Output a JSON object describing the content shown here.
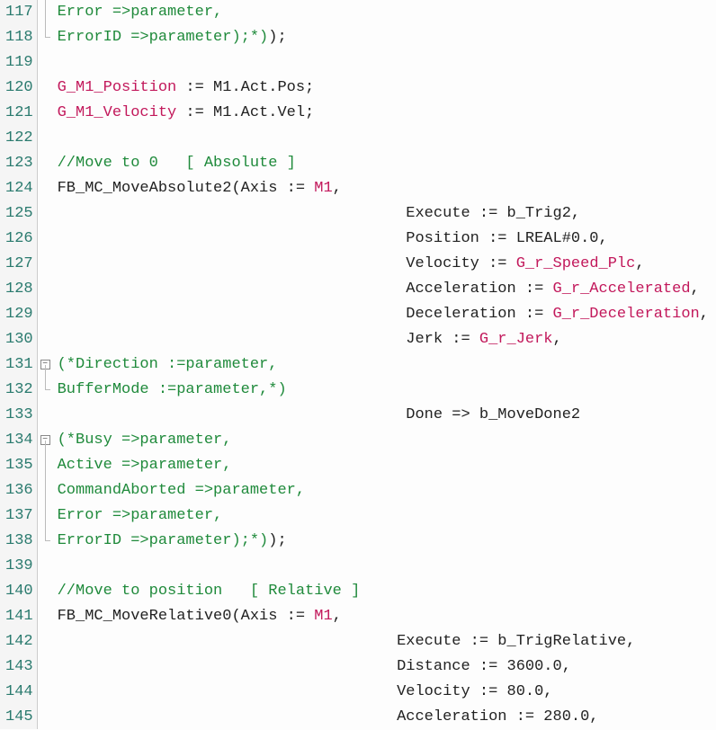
{
  "colors": {
    "ident": "#c2185b",
    "comment": "#1f8a3b",
    "text": "#222222",
    "gutter_fg": "#2a7a6e"
  },
  "lines": [
    {
      "num": 117,
      "fold": "line",
      "segs": [
        {
          "t": "                                      ",
          "c": "text"
        },
        {
          "t": "Error =>parameter,",
          "c": "comm"
        }
      ]
    },
    {
      "num": 118,
      "fold": "corner",
      "segs": [
        {
          "t": "                                      ",
          "c": "text"
        },
        {
          "t": "ErrorID =>parameter);*)",
          "c": "comm"
        },
        {
          "t": ");",
          "c": "text"
        }
      ]
    },
    {
      "num": 119,
      "fold": "",
      "segs": []
    },
    {
      "num": 120,
      "fold": "",
      "segs": [
        {
          "t": "G_M1_Position",
          "c": "ident"
        },
        {
          "t": " := M1.Act.Pos;",
          "c": "text"
        }
      ]
    },
    {
      "num": 121,
      "fold": "",
      "segs": [
        {
          "t": "G_M1_Velocity",
          "c": "ident"
        },
        {
          "t": " := M1.Act.Vel;",
          "c": "text"
        }
      ]
    },
    {
      "num": 122,
      "fold": "",
      "segs": []
    },
    {
      "num": 123,
      "fold": "",
      "segs": [
        {
          "t": "//Move to 0   [ Absolute ]",
          "c": "comm"
        }
      ]
    },
    {
      "num": 124,
      "fold": "",
      "segs": [
        {
          "t": "FB_MC_MoveAbsolute2(Axis := ",
          "c": "text"
        },
        {
          "t": "M1",
          "c": "ident"
        },
        {
          "t": ",",
          "c": "text"
        }
      ]
    },
    {
      "num": 125,
      "fold": "",
      "segs": [
        {
          "t": "                                      Execute := b_Trig2,",
          "c": "text"
        }
      ]
    },
    {
      "num": 126,
      "fold": "",
      "segs": [
        {
          "t": "                                      Position := LREAL#0.0,",
          "c": "text"
        }
      ]
    },
    {
      "num": 127,
      "fold": "",
      "segs": [
        {
          "t": "                                      Velocity := ",
          "c": "text"
        },
        {
          "t": "G_r_Speed_Plc",
          "c": "ident"
        },
        {
          "t": ",",
          "c": "text"
        }
      ]
    },
    {
      "num": 128,
      "fold": "",
      "segs": [
        {
          "t": "                                      Acceleration := ",
          "c": "text"
        },
        {
          "t": "G_r_Accelerated",
          "c": "ident"
        },
        {
          "t": ",",
          "c": "text"
        }
      ]
    },
    {
      "num": 129,
      "fold": "",
      "segs": [
        {
          "t": "                                      Deceleration := ",
          "c": "text"
        },
        {
          "t": "G_r_Deceleration",
          "c": "ident"
        },
        {
          "t": ",",
          "c": "text"
        }
      ]
    },
    {
      "num": 130,
      "fold": "",
      "segs": [
        {
          "t": "                                      Jerk := ",
          "c": "text"
        },
        {
          "t": "G_r_Jerk",
          "c": "ident"
        },
        {
          "t": ",",
          "c": "text"
        }
      ]
    },
    {
      "num": 131,
      "fold": "box",
      "segs": [
        {
          "t": "                                      ",
          "c": "text"
        },
        {
          "t": "(*Direction :=parameter,",
          "c": "comm"
        }
      ]
    },
    {
      "num": 132,
      "fold": "corner",
      "segs": [
        {
          "t": "                                      ",
          "c": "text"
        },
        {
          "t": "BufferMode :=parameter,*)",
          "c": "comm"
        }
      ]
    },
    {
      "num": 133,
      "fold": "",
      "segs": [
        {
          "t": "                                      Done => b_MoveDone2",
          "c": "text"
        }
      ]
    },
    {
      "num": 134,
      "fold": "box",
      "segs": [
        {
          "t": "                                      ",
          "c": "text"
        },
        {
          "t": "(*Busy =>parameter,",
          "c": "comm"
        }
      ]
    },
    {
      "num": 135,
      "fold": "line",
      "segs": [
        {
          "t": "                                      ",
          "c": "text"
        },
        {
          "t": "Active =>parameter,",
          "c": "comm"
        }
      ]
    },
    {
      "num": 136,
      "fold": "line",
      "segs": [
        {
          "t": "                                      ",
          "c": "text"
        },
        {
          "t": "CommandAborted =>parameter,",
          "c": "comm"
        }
      ]
    },
    {
      "num": 137,
      "fold": "line",
      "segs": [
        {
          "t": "                                      ",
          "c": "text"
        },
        {
          "t": "Error =>parameter,",
          "c": "comm"
        }
      ]
    },
    {
      "num": 138,
      "fold": "corner",
      "segs": [
        {
          "t": "                                      ",
          "c": "text"
        },
        {
          "t": "ErrorID =>parameter);*)",
          "c": "comm"
        },
        {
          "t": ");",
          "c": "text"
        }
      ]
    },
    {
      "num": 139,
      "fold": "",
      "segs": []
    },
    {
      "num": 140,
      "fold": "",
      "segs": [
        {
          "t": "//Move to position   [ Relative ]",
          "c": "comm"
        }
      ]
    },
    {
      "num": 141,
      "fold": "",
      "segs": [
        {
          "t": "FB_MC_MoveRelative0(Axis := ",
          "c": "text"
        },
        {
          "t": "M1",
          "c": "ident"
        },
        {
          "t": ",",
          "c": "text"
        }
      ]
    },
    {
      "num": 142,
      "fold": "",
      "segs": [
        {
          "t": "                                     Execute := b_TrigRelative,",
          "c": "text"
        }
      ]
    },
    {
      "num": 143,
      "fold": "",
      "segs": [
        {
          "t": "                                     Distance := 3600.0,",
          "c": "text"
        }
      ]
    },
    {
      "num": 144,
      "fold": "",
      "segs": [
        {
          "t": "                                     Velocity := 80.0,",
          "c": "text"
        }
      ]
    },
    {
      "num": 145,
      "fold": "",
      "segs": [
        {
          "t": "                                     Acceleration := 280.0,",
          "c": "text"
        }
      ]
    }
  ],
  "fold_glyph": "−"
}
